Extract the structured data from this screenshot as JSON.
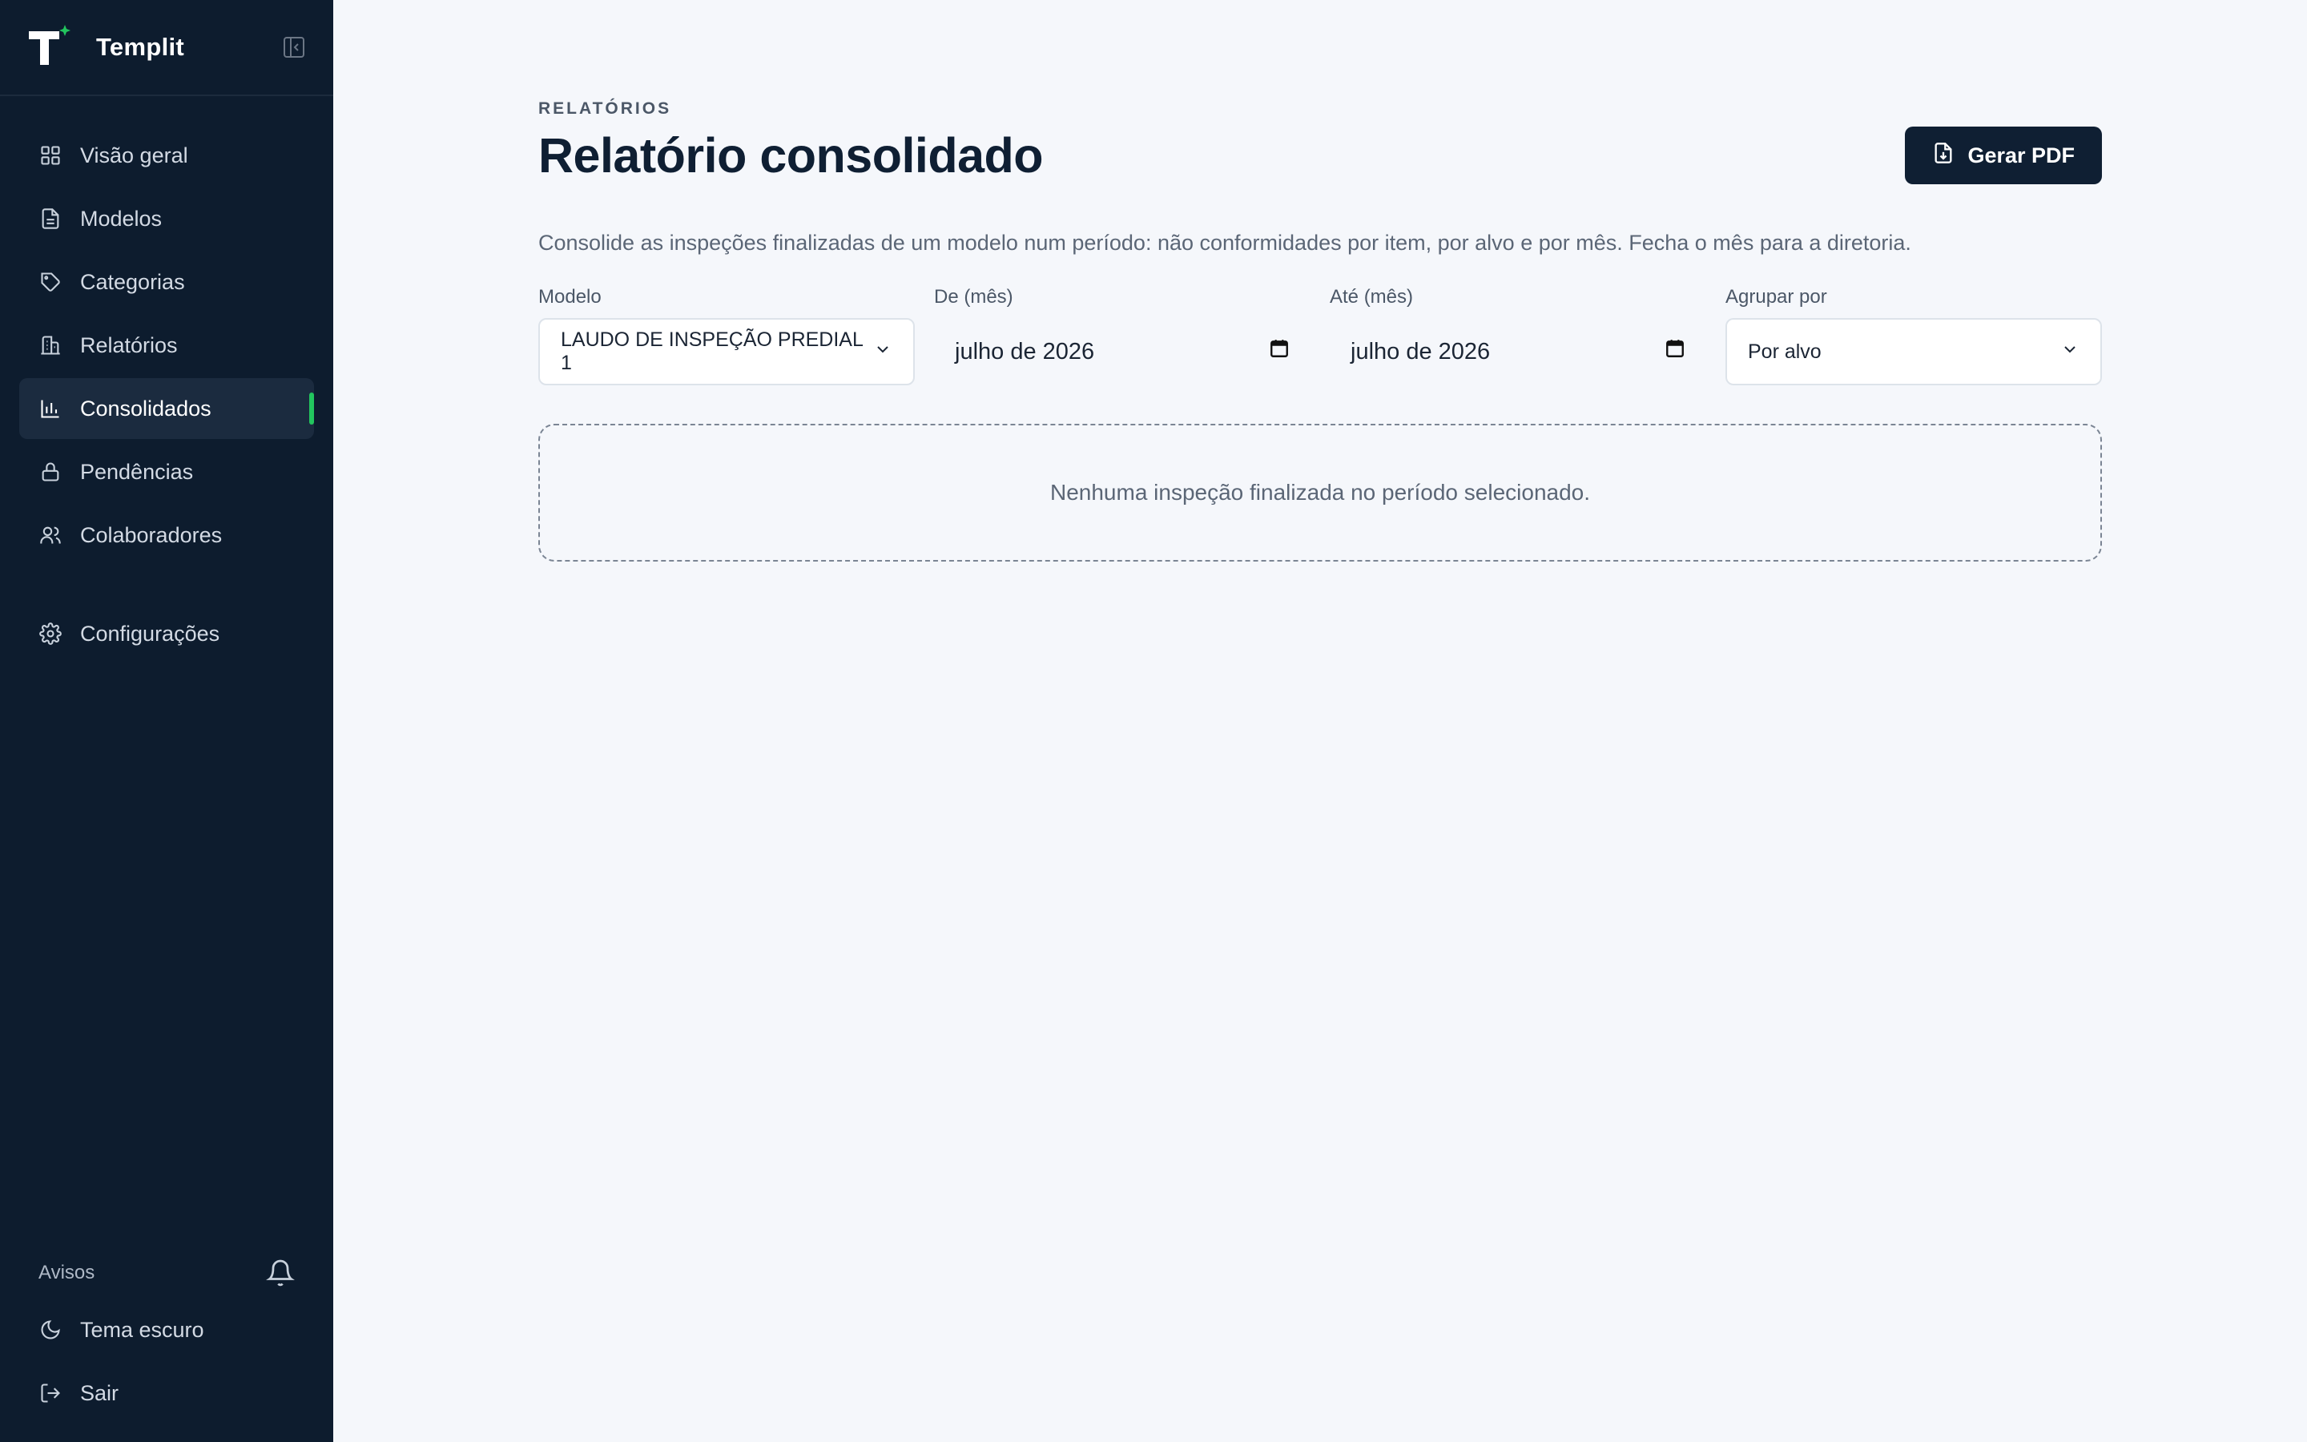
{
  "brand": {
    "name": "Templit"
  },
  "sidebar": {
    "items": [
      {
        "label": "Visão geral",
        "icon": "grid-icon"
      },
      {
        "label": "Modelos",
        "icon": "document-icon"
      },
      {
        "label": "Categorias",
        "icon": "tag-icon"
      },
      {
        "label": "Relatórios",
        "icon": "building-icon"
      },
      {
        "label": "Consolidados",
        "icon": "bar-chart-icon",
        "active": true
      },
      {
        "label": "Pendências",
        "icon": "lock-icon"
      },
      {
        "label": "Colaboradores",
        "icon": "users-icon"
      }
    ],
    "settings": {
      "label": "Configurações",
      "icon": "gear-icon"
    },
    "notices_label": "Avisos",
    "theme_label": "Tema escuro",
    "logout_label": "Sair"
  },
  "header": {
    "eyebrow": "RELATÓRIOS",
    "title": "Relatório consolidado",
    "pdf_button": "Gerar PDF"
  },
  "description": "Consolide as inspeções finalizadas de um modelo num período: não conformidades por item, por alvo e por mês. Fecha o mês para a diretoria.",
  "filters": {
    "model": {
      "label": "Modelo",
      "value": "LAUDO DE INSPEÇÃO PREDIAL 1"
    },
    "from": {
      "label": "De (mês)",
      "value": "julho de 2026"
    },
    "to": {
      "label": "Até (mês)",
      "value": "julho de 2026"
    },
    "group": {
      "label": "Agrupar por",
      "value": "Por alvo"
    }
  },
  "empty_state": "Nenhuma inspeção finalizada no período selecionado.",
  "colors": {
    "sidebar": "#0d1c2e",
    "accent": "#22c55e",
    "primary": "#0f1f33"
  }
}
